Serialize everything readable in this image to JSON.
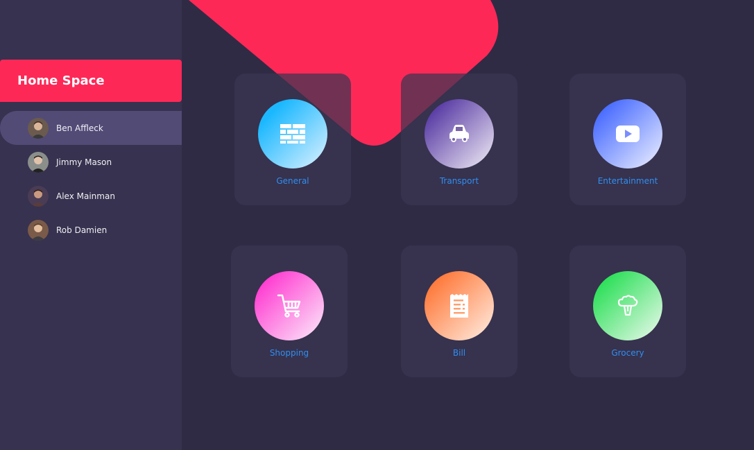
{
  "sidebar": {
    "title": "Home Space",
    "users": [
      {
        "name": "Ben Affleck",
        "active": true,
        "avatar_color": "#6b5a4e"
      },
      {
        "name": "Jimmy Mason",
        "active": false,
        "avatar_color": "#8a8f8c"
      },
      {
        "name": "Alex Mainman",
        "active": false,
        "avatar_color": "#4a3c55"
      },
      {
        "name": "Rob Damien",
        "active": false,
        "avatar_color": "#7a5a48"
      }
    ]
  },
  "categories": [
    {
      "label": "General",
      "icon": "brick-wall-icon",
      "gradient": [
        "#1cb8ff",
        "#dff2ff"
      ]
    },
    {
      "label": "Transport",
      "icon": "car-icon",
      "gradient": [
        "#5b3ea6",
        "#f2eef6"
      ]
    },
    {
      "label": "Entertainment",
      "icon": "video-play-icon",
      "gradient": [
        "#4a6dff",
        "#f0f2ff"
      ]
    },
    {
      "label": "Shopping",
      "icon": "shopping-cart-icon",
      "gradient": [
        "#ff3fd2",
        "#fbeefb"
      ]
    },
    {
      "label": "Bill",
      "icon": "receipt-icon",
      "gradient": [
        "#ff7a3c",
        "#fff0e6"
      ]
    },
    {
      "label": "Grocery",
      "icon": "broccoli-icon",
      "gradient": [
        "#2ee05a",
        "#f0faf0"
      ]
    }
  ],
  "colors": {
    "accent": "#fe2857",
    "background": "#2f2b45",
    "sidebar": "#37324f",
    "active_user": "#524b76",
    "label": "#2f8ff0"
  }
}
